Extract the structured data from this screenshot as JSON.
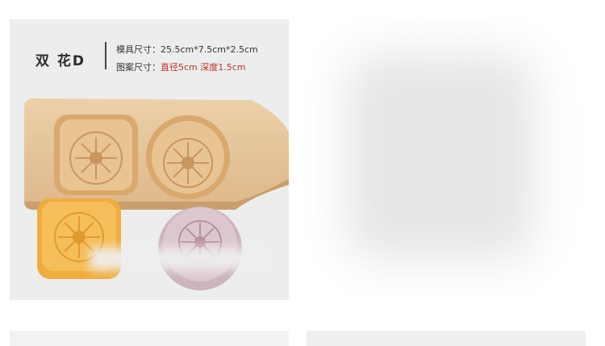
{
  "product": {
    "title": "双 花D",
    "mold_size_label": "模具尺寸：",
    "mold_size_value": "25.5cm*7.5cm*2.5cm",
    "pattern_size_label": "图案尺寸：",
    "diameter": "直径5cm",
    "depth": "深度1.5cm"
  },
  "colors": {
    "accent_red": "#c0302a",
    "wood": "#e8c9a0",
    "orange_cake": "#f2b54a",
    "pink_cake": "#d9c4cc"
  }
}
